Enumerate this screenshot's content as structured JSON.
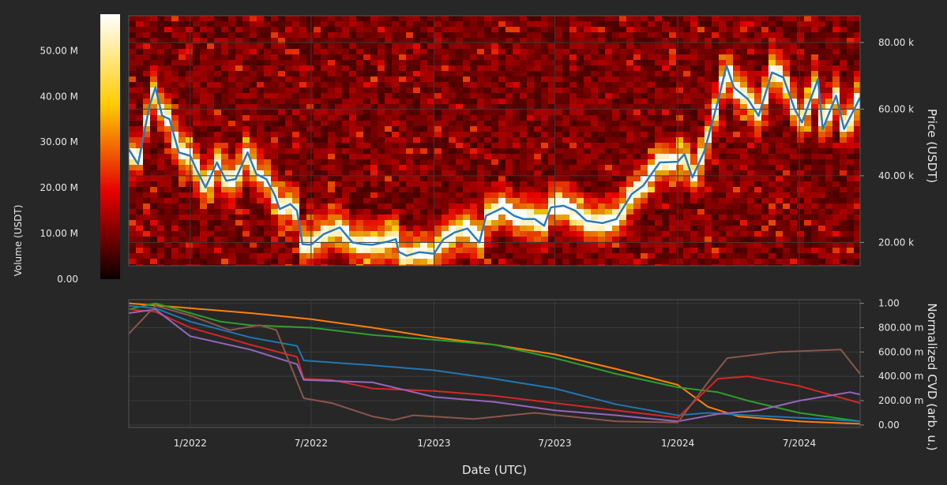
{
  "colors": {
    "background": "#272727",
    "plot_background": "#0c0405",
    "price_line": "#2b7bba",
    "grid": "#3a3a3a",
    "cvd_series": [
      "#ff7f0e",
      "#2ca02c",
      "#1f77b4",
      "#d62728",
      "#9467bd",
      "#8c564b"
    ]
  },
  "colorbar": {
    "label": "Volume (USDT)",
    "ticks": [
      "0.00",
      "10.00 M",
      "20.00 M",
      "30.00 M",
      "40.00 M",
      "50.00 M"
    ],
    "colormap": "hot",
    "range": [
      0,
      58000000
    ]
  },
  "chart_data": [
    {
      "type": "heatmap",
      "ylabel": "Price (USDT)",
      "y_ticks": [
        "20.00 k",
        "40.00 k",
        "60.00 k",
        "80.00 k"
      ],
      "ylim": [
        13000,
        88000
      ],
      "xlim": [
        "2021-10-01",
        "2024-09-30"
      ],
      "grid": true,
      "series": [
        {
          "type": "line",
          "x": [
            "2021-10-01",
            "2021-10-15",
            "2021-11-01",
            "2021-11-10",
            "2021-11-20",
            "2021-12-01",
            "2021-12-15",
            "2022-01-01",
            "2022-01-10",
            "2022-01-24",
            "2022-02-10",
            "2022-02-24",
            "2022-03-10",
            "2022-03-28",
            "2022-04-10",
            "2022-04-25",
            "2022-05-08",
            "2022-05-15",
            "2022-05-31",
            "2022-06-10",
            "2022-06-18",
            "2022-07-01",
            "2022-07-20",
            "2022-08-01",
            "2022-08-13",
            "2022-09-01",
            "2022-09-15",
            "2022-10-01",
            "2022-10-25",
            "2022-11-05",
            "2022-11-09",
            "2022-11-21",
            "2022-12-10",
            "2023-01-01",
            "2023-01-15",
            "2023-02-01",
            "2023-02-20",
            "2023-03-10",
            "2023-03-20",
            "2023-04-14",
            "2023-05-01",
            "2023-05-15",
            "2023-06-01",
            "2023-06-15",
            "2023-06-25",
            "2023-07-14",
            "2023-08-01",
            "2023-08-17",
            "2023-09-10",
            "2023-10-01",
            "2023-10-24",
            "2023-11-10",
            "2023-12-05",
            "2024-01-01",
            "2024-01-11",
            "2024-01-23",
            "2024-02-10",
            "2024-02-29",
            "2024-03-14",
            "2024-03-25",
            "2024-04-15",
            "2024-05-01",
            "2024-05-21",
            "2024-06-07",
            "2024-06-24",
            "2024-07-05",
            "2024-07-29",
            "2024-08-05",
            "2024-08-25",
            "2024-09-06",
            "2024-09-30"
          ],
          "values": [
            48000,
            43500,
            61000,
            66500,
            58000,
            57000,
            47000,
            46000,
            42000,
            36500,
            44000,
            38500,
            39000,
            47000,
            40500,
            39000,
            34000,
            30000,
            31500,
            29500,
            19500,
            19300,
            22500,
            23500,
            24500,
            20000,
            19500,
            19300,
            20300,
            21000,
            17200,
            16000,
            17100,
            16600,
            20900,
            23000,
            24200,
            20000,
            28000,
            30400,
            28000,
            27000,
            27000,
            25000,
            30500,
            31000,
            29500,
            26500,
            25800,
            27000,
            34500,
            37000,
            44000,
            44200,
            46500,
            39500,
            47500,
            61500,
            73000,
            66500,
            63000,
            58000,
            71000,
            69500,
            60000,
            56000,
            69000,
            54000,
            64000,
            54000,
            63500
          ]
        }
      ]
    },
    {
      "type": "line",
      "xlabel": "Date (UTC)",
      "ylabel": "Normalized CVD (arb. u.)",
      "x_ticks": [
        "1/2022",
        "7/2022",
        "1/2023",
        "7/2023",
        "1/2024",
        "7/2024"
      ],
      "y_ticks": [
        "0.00",
        "200.00 m",
        "400.00 m",
        "600.00 m",
        "800.00 m",
        "1.00"
      ],
      "ylim": [
        -0.02,
        1.03
      ],
      "xlim": [
        "2021-10-01",
        "2024-09-30"
      ],
      "grid": true,
      "series": [
        {
          "x": [
            "2021-10-01",
            "2022-01-01",
            "2022-04-01",
            "2022-07-01",
            "2022-10-01",
            "2023-01-01",
            "2023-04-01",
            "2023-07-01",
            "2023-10-01",
            "2024-01-01",
            "2024-02-15",
            "2024-04-01",
            "2024-07-01",
            "2024-09-30"
          ],
          "values": [
            1.0,
            0.96,
            0.92,
            0.87,
            0.8,
            0.72,
            0.66,
            0.58,
            0.46,
            0.33,
            0.15,
            0.07,
            0.03,
            0.01
          ]
        },
        {
          "x": [
            "2021-10-01",
            "2021-11-10",
            "2022-01-01",
            "2022-02-15",
            "2022-04-01",
            "2022-07-01",
            "2022-10-01",
            "2023-01-01",
            "2023-04-01",
            "2023-07-01",
            "2023-10-01",
            "2024-01-01",
            "2024-03-01",
            "2024-04-15",
            "2024-07-01",
            "2024-09-30"
          ],
          "values": [
            0.95,
            1.0,
            0.92,
            0.85,
            0.82,
            0.8,
            0.74,
            0.7,
            0.66,
            0.55,
            0.42,
            0.31,
            0.27,
            0.2,
            0.1,
            0.03
          ]
        },
        {
          "x": [
            "2021-10-01",
            "2021-11-10",
            "2022-01-01",
            "2022-04-01",
            "2022-06-10",
            "2022-06-20",
            "2022-10-01",
            "2023-01-01",
            "2023-04-01",
            "2023-07-01",
            "2023-10-01",
            "2024-01-01",
            "2024-02-15",
            "2024-04-15",
            "2024-07-01",
            "2024-09-30"
          ],
          "values": [
            0.98,
            0.96,
            0.85,
            0.72,
            0.65,
            0.53,
            0.49,
            0.45,
            0.38,
            0.3,
            0.17,
            0.08,
            0.1,
            0.08,
            0.06,
            0.03
          ]
        },
        {
          "x": [
            "2021-10-01",
            "2021-11-10",
            "2022-01-01",
            "2022-04-01",
            "2022-06-10",
            "2022-06-20",
            "2022-08-01",
            "2022-10-01",
            "2023-01-01",
            "2023-04-01",
            "2023-07-01",
            "2023-10-01",
            "2024-01-01",
            "2024-03-01",
            "2024-04-15",
            "2024-07-01",
            "2024-09-30"
          ],
          "values": [
            0.95,
            0.93,
            0.8,
            0.66,
            0.56,
            0.38,
            0.37,
            0.3,
            0.28,
            0.24,
            0.18,
            0.12,
            0.06,
            0.38,
            0.4,
            0.32,
            0.18
          ]
        },
        {
          "x": [
            "2021-10-01",
            "2021-11-10",
            "2022-01-01",
            "2022-04-01",
            "2022-06-10",
            "2022-06-20",
            "2022-10-01",
            "2023-01-01",
            "2023-04-01",
            "2023-07-01",
            "2023-10-01",
            "2024-01-01",
            "2024-03-01",
            "2024-05-01",
            "2024-07-01",
            "2024-09-15",
            "2024-09-30"
          ],
          "values": [
            0.92,
            0.95,
            0.73,
            0.62,
            0.5,
            0.37,
            0.35,
            0.23,
            0.19,
            0.12,
            0.08,
            0.03,
            0.09,
            0.12,
            0.2,
            0.27,
            0.25
          ]
        },
        {
          "x": [
            "2021-10-01",
            "2021-11-10",
            "2022-01-01",
            "2022-03-01",
            "2022-04-15",
            "2022-05-10",
            "2022-06-20",
            "2022-08-01",
            "2022-10-01",
            "2022-11-01",
            "2022-12-01",
            "2023-03-01",
            "2023-06-01",
            "2023-10-01",
            "2024-01-01",
            "2024-02-15",
            "2024-03-15",
            "2024-06-01",
            "2024-09-01",
            "2024-09-30"
          ],
          "values": [
            0.75,
            0.98,
            0.9,
            0.78,
            0.82,
            0.78,
            0.22,
            0.18,
            0.07,
            0.04,
            0.08,
            0.05,
            0.1,
            0.03,
            0.02,
            0.35,
            0.55,
            0.6,
            0.62,
            0.42
          ]
        }
      ]
    }
  ]
}
